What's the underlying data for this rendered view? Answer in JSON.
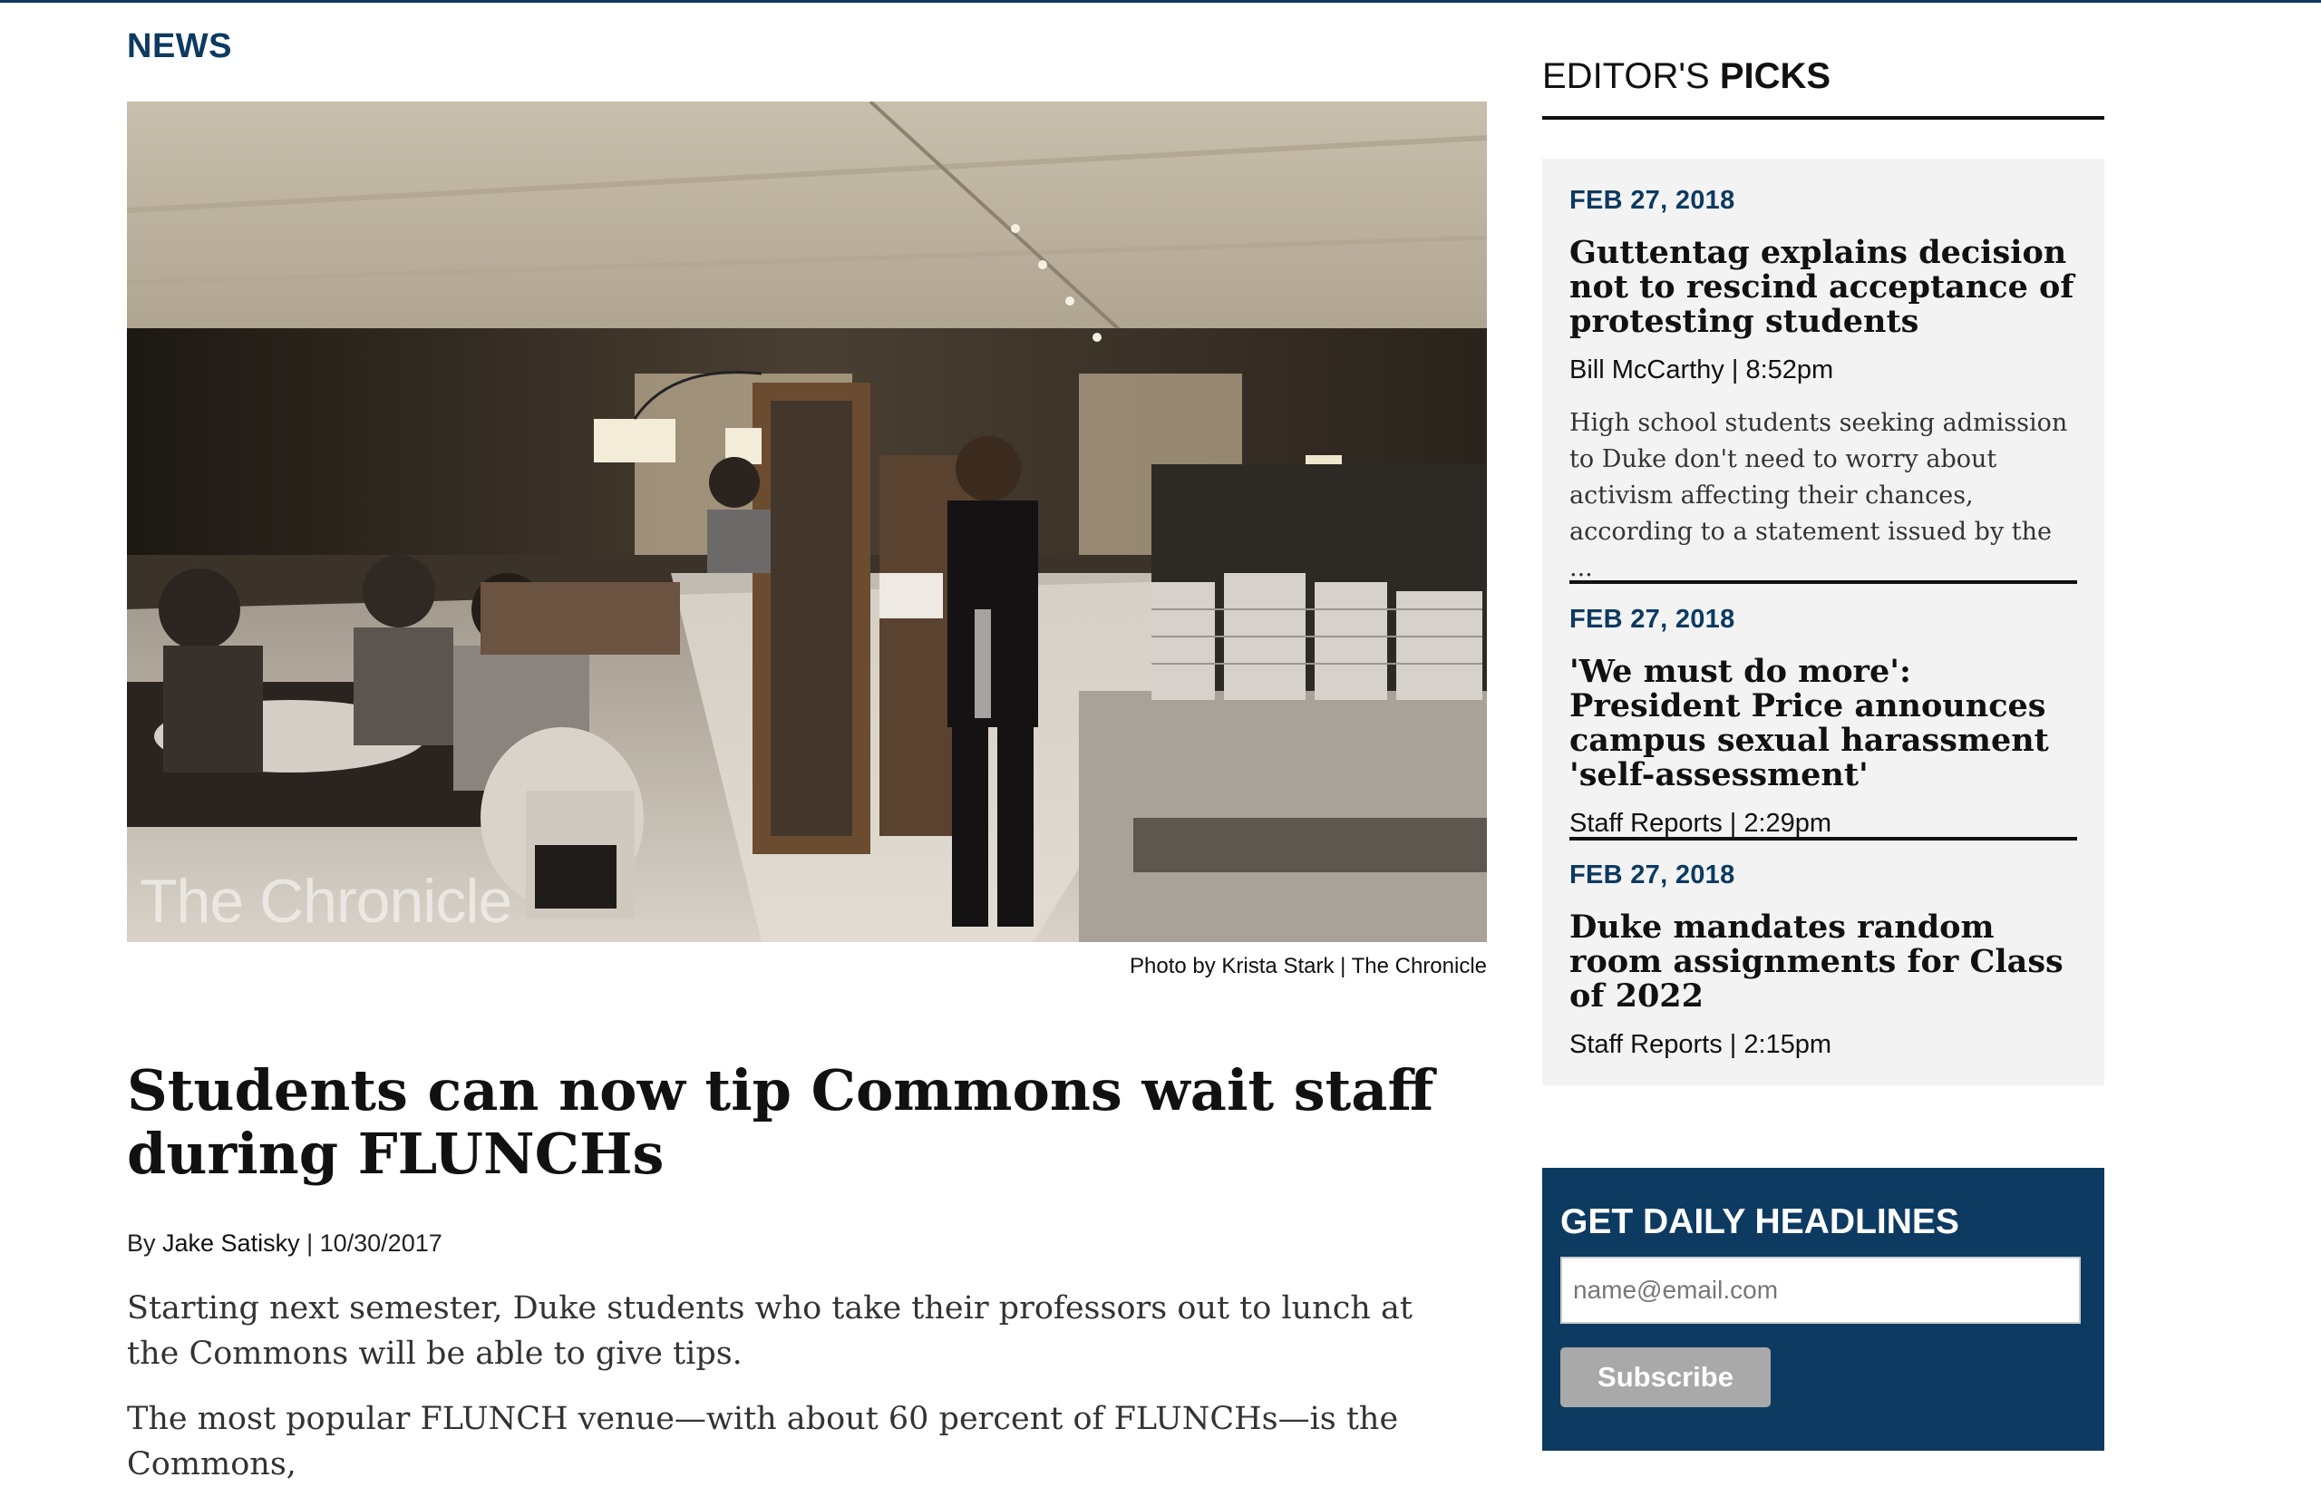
{
  "section": {
    "label": "NEWS"
  },
  "hero": {
    "watermark": "The Chronicle",
    "credit_prefix": "Photo by ",
    "credit_name": "Krista Stark",
    "credit_separator": " | ",
    "credit_source": "The Chronicle"
  },
  "article": {
    "headline": "Students can now tip Commons wait staff during FLUNCHs",
    "by_prefix": "By ",
    "author": "Jake Satisky",
    "date_separator": " | ",
    "date": "10/30/2017",
    "paragraphs": [
      "Starting next semester, Duke students who take their professors out to lunch at the Commons will be able to give tips.",
      "The most popular FLUNCH venue—with about 60 percent of FLUNCHs—is the Commons,"
    ]
  },
  "sidebar": {
    "title_light": "EDITOR'S ",
    "title_bold": "PICKS",
    "picks": [
      {
        "date": "FEB 27, 2018",
        "title": "Guttentag explains decision not to rescind acceptance of protesting students",
        "meta": "Bill McCarthy | 8:52pm",
        "excerpt": "High school students seeking admission to Duke don't need to worry about activism affecting their chances, according to a statement issued by the ..."
      },
      {
        "date": "FEB 27, 2018",
        "title": "'We must do more': President Price announces campus sexual harassment 'self-assessment'",
        "meta": "Staff Reports | 2:29pm"
      },
      {
        "date": "FEB 27, 2018",
        "title": "Duke mandates random room assignments for Class of 2022",
        "meta": "Staff Reports | 2:15pm"
      }
    ]
  },
  "newsletter": {
    "title": "GET DAILY HEADLINES",
    "placeholder": "name@email.com",
    "button": "Subscribe"
  },
  "colors": {
    "accent": "#0d3a61",
    "sidebar_bg": "#f3f3f3",
    "button_bg": "#a9a9a9"
  }
}
